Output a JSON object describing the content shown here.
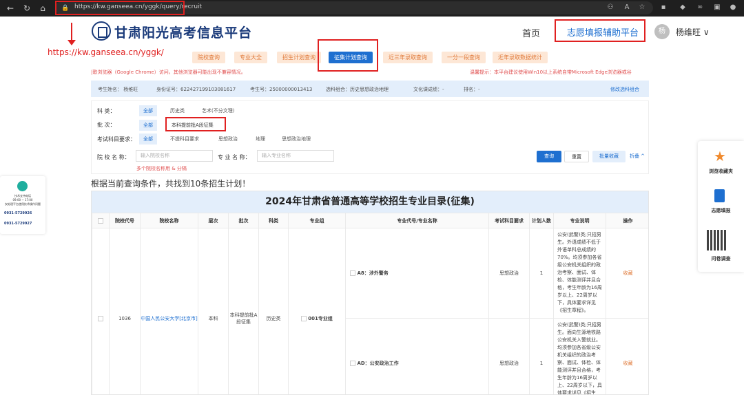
{
  "browser": {
    "url": "https://kw.ganseea.cn/yggk/query/recruit"
  },
  "header": {
    "site_title": "甘肃阳光高考信息平台",
    "home": "首页",
    "assist": "志愿填报辅助平台",
    "avatar_initial": "杨",
    "user_name": "杨维旺 ∨"
  },
  "annotation": {
    "url_text": "https://kw.ganseea.cn/yggk/"
  },
  "tabs": [
    "院校查询",
    "专业大全",
    "招生计划查询",
    "征集计划查询",
    "近三年录取查询",
    "一分一段查询",
    "近年录取数据统计"
  ],
  "notices": {
    "left": "|歌浏览器（Google Chrome）访问，其他浏览器可能出现不兼容情况。",
    "right": "温馨提示：本平台建议使用Win10以上系统自带Microsoft Edge浏览器或谷"
  },
  "info": {
    "name": "考生姓名：  杨维旺",
    "id": "身份证号：622427199103081617",
    "exam_no": "考生号：25000000013413",
    "subjects": "选科组合：历史思想政治地理",
    "score": "文化课成绩：-",
    "rank": "排名：-",
    "edit": "修改选科组合"
  },
  "filters": {
    "category_label": "科        类：",
    "category_opts": [
      "全部",
      "历史类",
      "艺术(不分文理)"
    ],
    "batch_label": "批        次：",
    "batch_opts": [
      "全部",
      "本科提前批A段征集"
    ],
    "req_label": "考试科目要求：",
    "req_opts": [
      "全部",
      "不提科目要求",
      "思想政治",
      "地理",
      "思想政治地理"
    ],
    "school_label": "院 校 名 称：",
    "school_placeholder": "输入院校名称",
    "major_label": "专 业 名 称：",
    "major_placeholder": "输入专业名称",
    "hint": "多个院校名称用 & 分隔",
    "query": "查询",
    "reset": "重置",
    "batch_fav": "批量收藏",
    "collapse": "折叠 ^"
  },
  "result": "根据当前查询条件，共找到10条招生计划！",
  "table": {
    "title": "2024年甘肃省普通高等学校招生专业目录(征集)",
    "headers": [
      "院校代号",
      "院校名称",
      "层次",
      "批次",
      "科类",
      "专业组",
      "专业代号/专业名称",
      "考试科目要求",
      "计划人数",
      "专业说明",
      "操作"
    ],
    "school_code": "1036",
    "school_name": "中国人民公安大学[北京市]",
    "level": "本科",
    "batch": "本科提前批A段征集",
    "category": "历史类",
    "group": "001专业组",
    "rows": [
      {
        "major": "A8：涉外警务",
        "req": "思想政治",
        "count": "1",
        "desc": "公安(武警)类;只招男生。外语成绩不低于外语单科总成绩的70%。均须参加各省级公安机关组织的政治考察、面试、体检、体能测评并且合格，考生年龄为16周岁以上、22周岁以下，具体要求详见《招生章程》。",
        "op": "收藏"
      },
      {
        "major": "AD：公安政治工作",
        "req": "思想政治",
        "count": "1",
        "desc": "公安(武警)类;只招男生。面向生源地铁路公安机关入警就业。均须参加各省级公安机关组织的政治考察、面试、体检、体能测评并且合格，考生年龄为16周岁以上、22周岁以下，具体要求详见《招生",
        "op": "收藏"
      }
    ]
  },
  "left_widget": {
    "title": "技术支持电话",
    "hours": "09:00 ~ 17:00",
    "sub": "仅处理平台使用技术操作问题",
    "phone1": "0931-5729926",
    "phone2": "0931-5729927"
  },
  "right_widget": {
    "fav": "浏览收藏夹",
    "fill": "志愿填报",
    "survey": "问卷调查"
  }
}
